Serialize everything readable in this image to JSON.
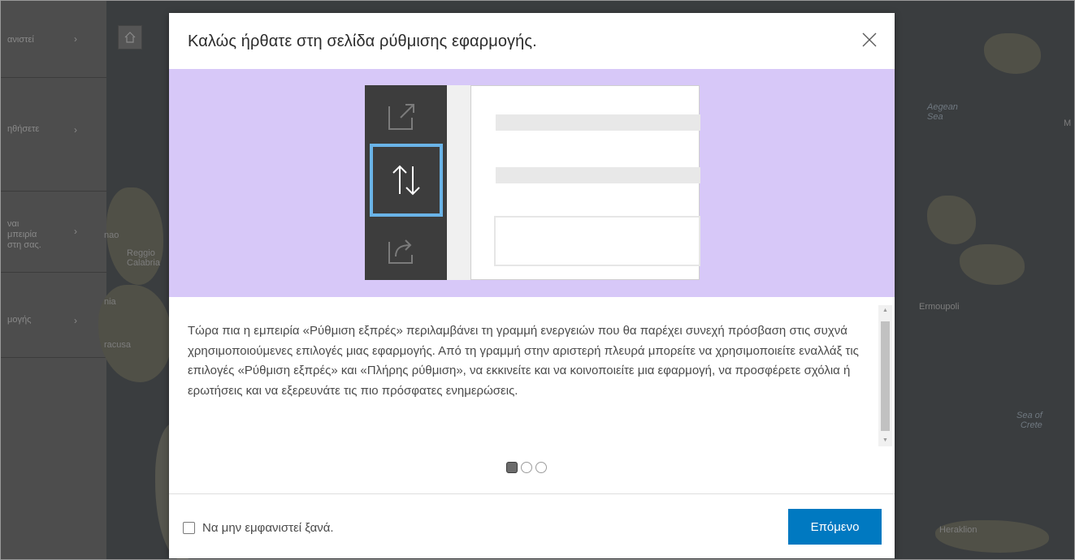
{
  "sidebar": {
    "items": [
      {
        "label": "ανιστεί"
      },
      {
        "label": "ηθήσετε"
      },
      {
        "label": "ναι\nμπειρία\nστη σας."
      },
      {
        "label": "μογής"
      }
    ]
  },
  "map": {
    "labels": {
      "reggio": "Reggio\nCalabria",
      "ermoupoli": "Ermoupoli",
      "aegean": "Aegean\nSea",
      "sea_of_crete": "Sea of\nCrete",
      "heraklion": "Heraklion",
      "siracusa": "racusa",
      "sicily_frag": "nia",
      "messina_frag": "nao",
      "m_frag": "M"
    }
  },
  "modal": {
    "title": "Καλώς ήρθατε στη σελίδα ρύθμισης εφαρμογής.",
    "body": "Τώρα πια η εμπειρία «Ρύθμιση εξπρές» περιλαμβάνει τη γραμμή ενεργειών που θα παρέχει συνεχή πρόσβαση στις συχνά χρησιμοποιούμενες επιλογές μιας εφαρμογής. Από τη γραμμή στην αριστερή πλευρά μπορείτε να χρησιμοποιείτε εναλλάξ τις επιλογές «Ρύθμιση εξπρές» και «Πλήρης ρύθμιση», να εκκινείτε και να κοινοποιείτε μια εφαρμογή, να προσφέρετε σχόλια ή ερωτήσεις και να εξερευνάτε τις πιο πρόσφατες ενημερώσεις.",
    "pager": {
      "current": 1,
      "total": 3
    },
    "dont_show_label": "Να μην εμφανιστεί ξανά.",
    "next_label": "Επόμενο"
  },
  "colors": {
    "accent": "#0079c1",
    "illustration_bg": "#d7c8f8",
    "highlight": "#6ab4e8"
  }
}
